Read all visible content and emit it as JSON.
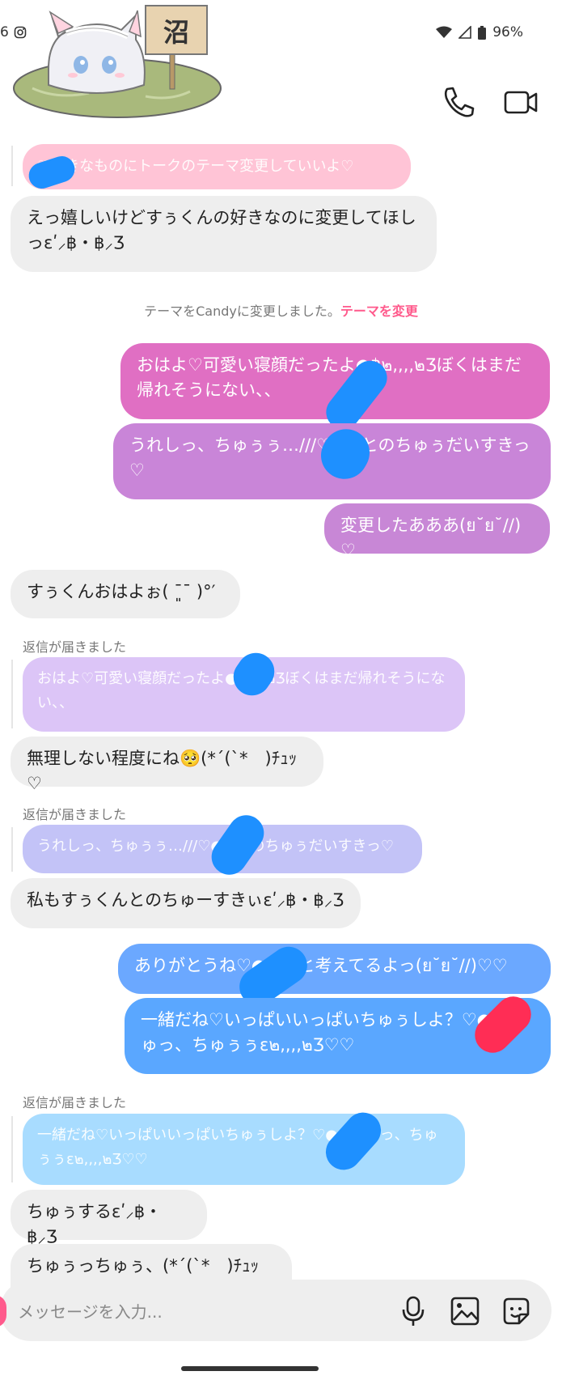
{
  "status": {
    "left_text": "6",
    "battery": "96%"
  },
  "sticker": {
    "sign_text": "沼"
  },
  "header": {
    "call_icon": "phone-icon",
    "video_icon": "video-camera-icon"
  },
  "messages": {
    "m1_quote_pink": "♡すきなものにトークのテーマ変更していいよ♡",
    "m2_in": "えっ嬉しいけどすぅくんの好きなのに変更してほしっɛʹ⸝฿・฿⸝Ʒ",
    "system_prefix": "テーマをCandyに変更しました。",
    "system_link": "テーマを変更",
    "m3_out": "おはよ♡可愛い寝顔だったよ●฿๒,,,,๒Ʒぼくはまだ帰れそうにない、、",
    "m4_out": "うれしっ、ちゅぅぅ…///♡●●とのちゅぅだいすきっ♡",
    "m5_out": "変更したあああ(ย˘ย˘//)♡",
    "m6_in": "すぅくんおはよぉ( ˉ͈ˉ )°′",
    "reply_label_1": "返信が届きました",
    "q1": "おはよ♡可愛い寝顔だったよ●๒,,,,๒Ʒぼくはまだ帰れそうにない、、",
    "m7_in": "無理しない程度にね🥺(*´(`*　)ﾁｭｯ♡",
    "reply_label_2": "返信が届きました",
    "q2": "うれしっ、ちゅぅぅ…///♡●●とのちゅぅだいすきっ♡",
    "m8_in": "私もすぅくんとのちゅーすきぃɛʹ⸝฿・฿⸝Ʒ",
    "m9_out": "ありがとうね♡●●こと考えてるよっ(ย˘ย˘//)♡♡",
    "m10_out": "一緒だね♡いっぱいいっぱいちゅぅしよ？♡●●ちゅっ、ちゅぅぅɛ๒,,,,๒Ʒ♡♡",
    "reply_label_3": "返信が届きました",
    "q3": "一緒だね♡いっぱいいっぱいちゅぅしよ？♡●●ちゅっ、ちゅぅぅɛ๒,,,,๒Ʒ♡♡",
    "m11_in": "ちゅぅするɛʹ⸝฿・฿⸝Ʒ",
    "m12_in": "ちゅぅっちゅぅ、(*´(`*　)ﾁｭｯ♡/"
  },
  "composer": {
    "placeholder": "メッセージを入力...",
    "mic_icon": "microphone-icon",
    "image_icon": "image-icon",
    "sticker_icon": "sticker-icon"
  },
  "colors": {
    "pink_bubble": "#ffc4d6",
    "out_grad_top": "#e06fc3",
    "out_grad_mid": "#c683da",
    "out_grad_bottom": "#5aa7ff",
    "quote_lilac": "#dcc5f7",
    "quote_periwinkle": "#c3c3f7",
    "quote_sky": "#a8dcff",
    "blot_blue": "#1e90ff",
    "blot_red": "#ff2d55"
  }
}
